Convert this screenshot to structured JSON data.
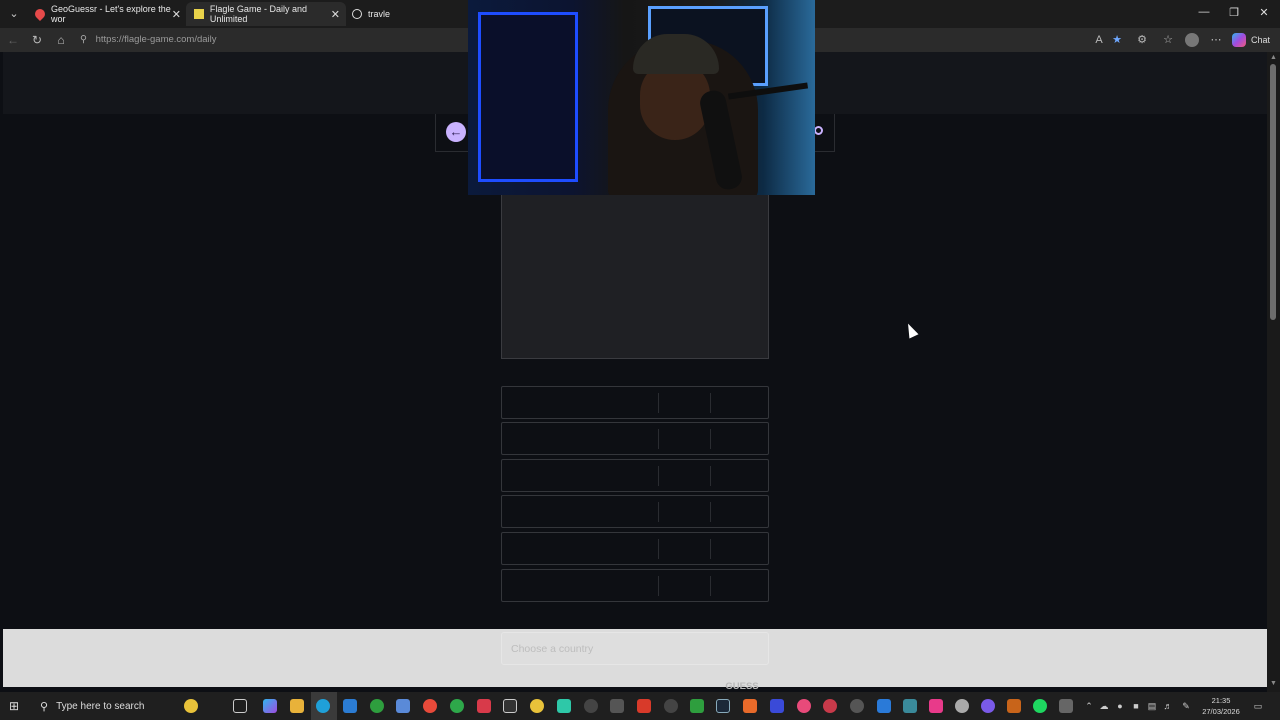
{
  "browser": {
    "tabs": [
      {
        "label": "GeoGuessr - Let's explore the wor",
        "icon": "geoguessr-pin-icon",
        "color": "#e64a4a"
      },
      {
        "label": "Flagle Game - Daily and Unlimited",
        "icon": "flagle-flag-icon",
        "color": "#e8d24a"
      },
      {
        "label": "travle",
        "icon": "travle-compass-icon",
        "color": "#dddddd"
      }
    ],
    "url": "https://flagle-game.com/daily",
    "chat_label": "Chat"
  },
  "game": {
    "country_placeholder": "Choose a country",
    "guess_label": "GUESS",
    "guess_rows": 6,
    "accent": "#c9b2ff"
  },
  "taskbar": {
    "search_placeholder": "Type here to search",
    "time": "21:35",
    "date": "27/03/2026"
  }
}
